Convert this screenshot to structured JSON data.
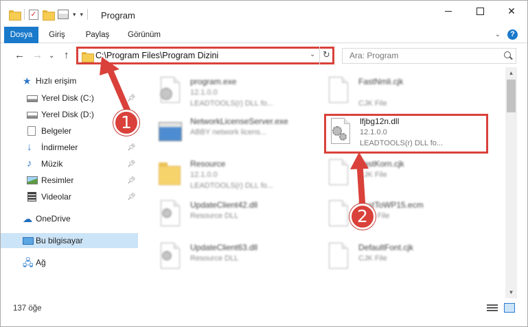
{
  "window": {
    "title": "Program"
  },
  "ribbon": {
    "tabs": [
      "Dosya",
      "Giriş",
      "Paylaş",
      "Görünüm"
    ],
    "help_label": "?"
  },
  "nav": {
    "address": "C:\\Program Files\\Program Dizini",
    "search_placeholder": "Ara: Program"
  },
  "sidebar": {
    "items": [
      {
        "label": "Hızlı erişim",
        "icon": "star-icon"
      },
      {
        "label": "Yerel Disk (C:)",
        "icon": "drive-icon",
        "pinned": true
      },
      {
        "label": "Yerel Disk (D:)",
        "icon": "drive-icon",
        "pinned": true
      },
      {
        "label": "Belgeler",
        "icon": "document-icon",
        "pinned": true
      },
      {
        "label": "İndirmeler",
        "icon": "download-icon",
        "pinned": true
      },
      {
        "label": "Müzik",
        "icon": "music-icon",
        "pinned": true
      },
      {
        "label": "Resimler",
        "icon": "picture-icon",
        "pinned": true
      },
      {
        "label": "Videolar",
        "icon": "video-icon",
        "pinned": true
      },
      {
        "label": "OneDrive",
        "icon": "cloud-icon"
      },
      {
        "label": "Bu bilgisayar",
        "icon": "computer-icon",
        "selected": true
      },
      {
        "label": "Ağ",
        "icon": "network-icon"
      }
    ]
  },
  "files": [
    {
      "name": "program.exe",
      "version": "12.1.0.0",
      "description": "LEADTOOLS(r) DLL fo...",
      "icon": "exe-icon"
    },
    {
      "name": "FastNmli.cjk",
      "version": "",
      "description": "CJK File",
      "icon": "file-icon"
    },
    {
      "name": "NetworkLicenseServer.exe",
      "version": "ABBY network licens...",
      "description": "",
      "icon": "exe-icon"
    },
    {
      "name": "lfjbg12n.dll",
      "version": "12.1.0.0",
      "description": "LEADTOOLS(r) DLL fo...",
      "icon": "dll-gear-icon"
    },
    {
      "name": "Resource",
      "version": "12.1.0.0",
      "description": "LEADTOOLS(r) DLL fo...",
      "icon": "folder-icon"
    },
    {
      "name": "FastKorn.cjk",
      "version": "CJK File",
      "description": "",
      "icon": "file-icon"
    },
    {
      "name": "UpdateClient42.dll",
      "version": "Resource DLL",
      "description": "",
      "icon": "dll-gear-icon"
    },
    {
      "name": "FastToWP15.ecm",
      "version": "ECM File",
      "description": "",
      "icon": "file-icon"
    },
    {
      "name": "UpdateClient63.dll",
      "version": "Resource DLL",
      "description": "",
      "icon": "dll-gear-icon"
    },
    {
      "name": "DefaultFont.cjk",
      "version": "CJK File",
      "description": "",
      "icon": "file-icon"
    }
  ],
  "status": {
    "item_count": "137 öğe"
  },
  "annotations": {
    "badge_1": "1",
    "badge_2": "2",
    "color": "#d9413a"
  }
}
